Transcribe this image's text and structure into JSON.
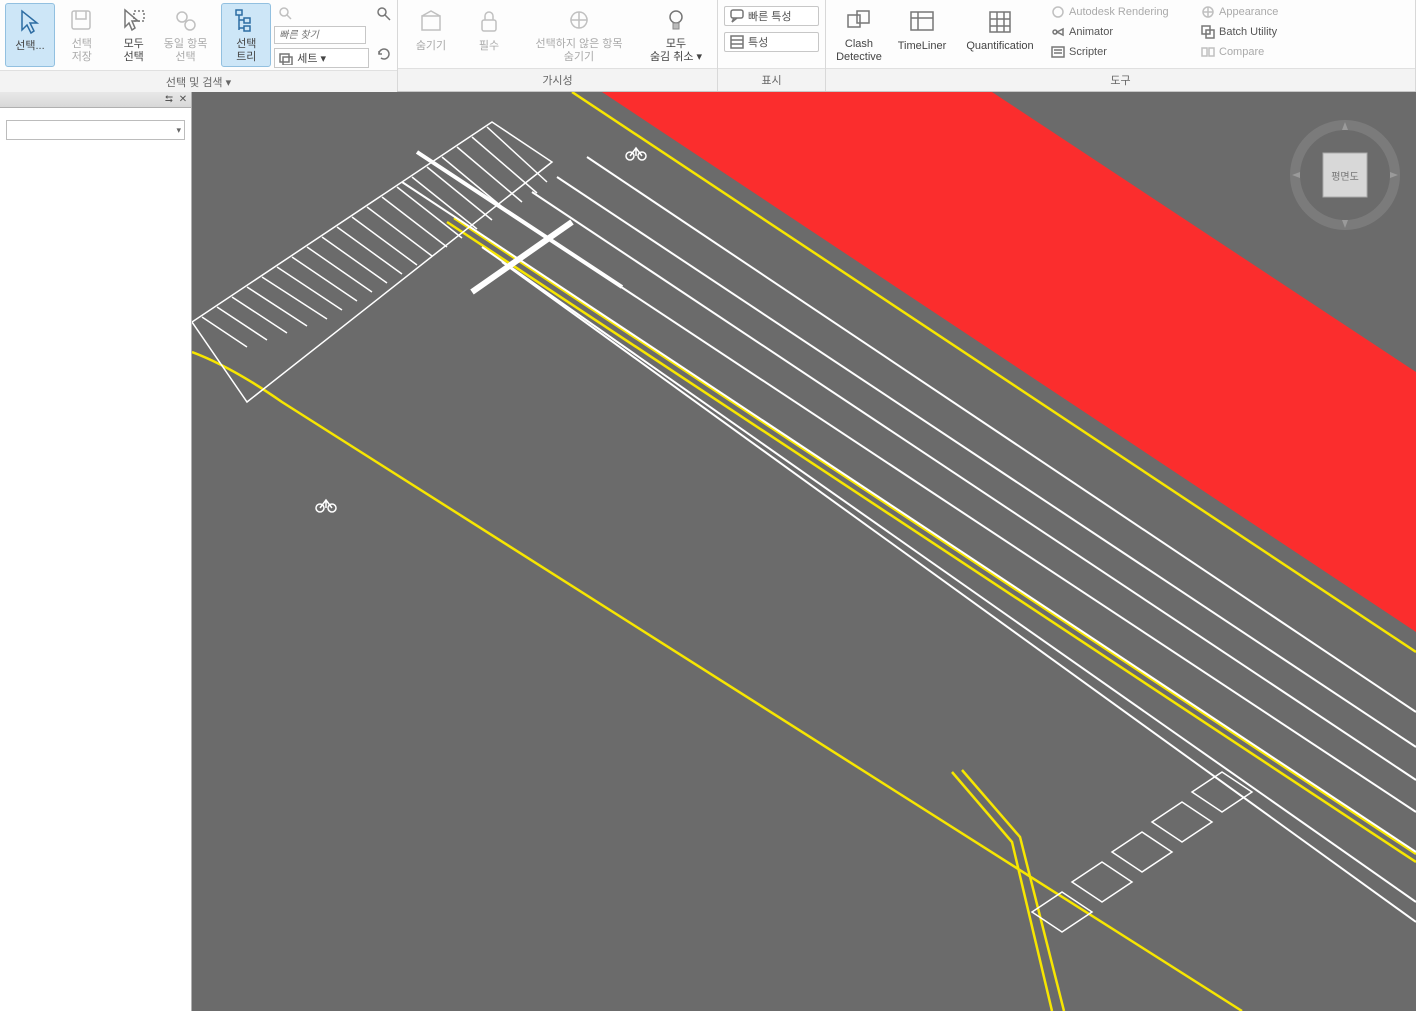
{
  "ribbon": {
    "groups": {
      "select_search": {
        "label": "선택 및 검색 ▾",
        "select_btn": "선택...",
        "save_selection": "선택\n저장",
        "select_all": "모두\n선택",
        "same_item": "동일 항목\n선택",
        "selection_tree": "선택\n트리",
        "quick_find_placeholder": "빠른 찾기",
        "sets_label": "세트 ▾"
      },
      "visibility": {
        "label": "가시성",
        "hide": "숨기기",
        "required": "필수",
        "hide_unselected": "선택하지 않은 항목\n숨기기",
        "unhide_all": "모두\n숨김 취소 ▾"
      },
      "display": {
        "label": "표시",
        "quick_props": "빠른 특성",
        "properties": "특성"
      },
      "tools": {
        "label": "도구",
        "clash": "Clash\nDetective",
        "timeliner": "TimeLiner",
        "quantification": "Quantification",
        "autodesk_rendering": "Autodesk Rendering",
        "animator": "Animator",
        "scripter": "Scripter",
        "appearance": "Appearance",
        "batch_utility": "Batch Utility",
        "compare": "Compare"
      }
    }
  },
  "navcube": {
    "face": "평면도"
  }
}
